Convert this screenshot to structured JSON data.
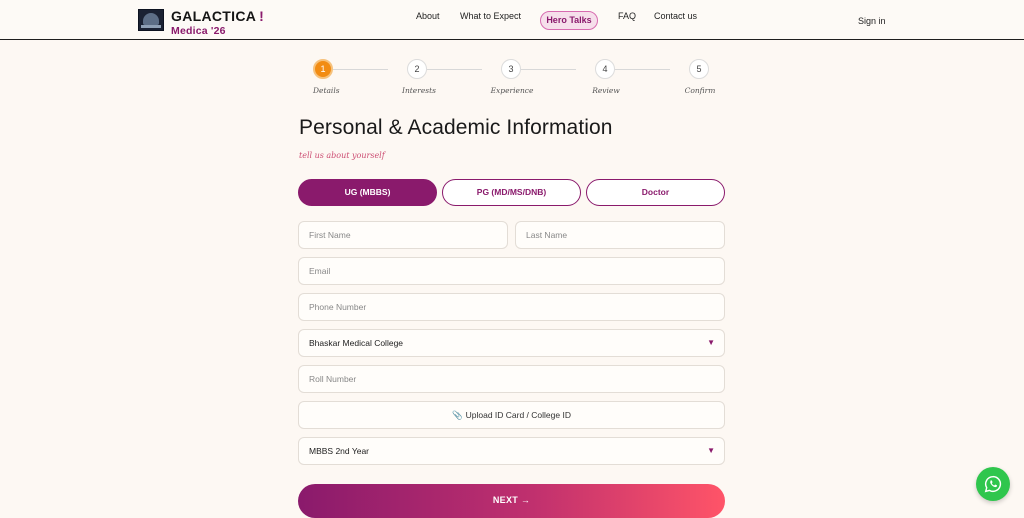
{
  "brand": {
    "name": "GALACTICA",
    "bang": "!",
    "subtitle": "Medica '26"
  },
  "nav": {
    "about": "About",
    "what_to_expect": "What to Expect",
    "hero_talks": "Hero Talks",
    "faq": "FAQ",
    "contact": "Contact us",
    "sign_in": "Sign in"
  },
  "stepper": {
    "steps": [
      {
        "num": "1",
        "label": "Details",
        "active": true
      },
      {
        "num": "2",
        "label": "Interests",
        "active": false
      },
      {
        "num": "3",
        "label": "Experience",
        "active": false
      },
      {
        "num": "4",
        "label": "Review",
        "active": false
      },
      {
        "num": "5",
        "label": "Confirm",
        "active": false
      }
    ]
  },
  "form": {
    "title": "Personal & Academic Information",
    "tagline": "tell us about yourself",
    "levels": [
      "UG (MBBS)",
      "PG (MD/MS/DNB)",
      "Doctor"
    ],
    "selected_level": "UG (MBBS)",
    "first_name_placeholder": "First Name",
    "last_name_placeholder": "Last Name",
    "email_placeholder": "Email",
    "phone_placeholder": "Phone Number",
    "college_value": "Bhaskar Medical College",
    "roll_placeholder": "Roll Number",
    "upload_label": "Upload ID Card / College ID",
    "year_value": "MBBS 2nd Year",
    "next_label": "NEXT →"
  },
  "colors": {
    "accent": "#8a1a6c",
    "step_active": "#f28c13",
    "whatsapp": "#2fc64d"
  },
  "icons": {
    "upload": "paperclip-icon",
    "dropdown": "caret-down-icon",
    "chat": "whatsapp-icon"
  }
}
